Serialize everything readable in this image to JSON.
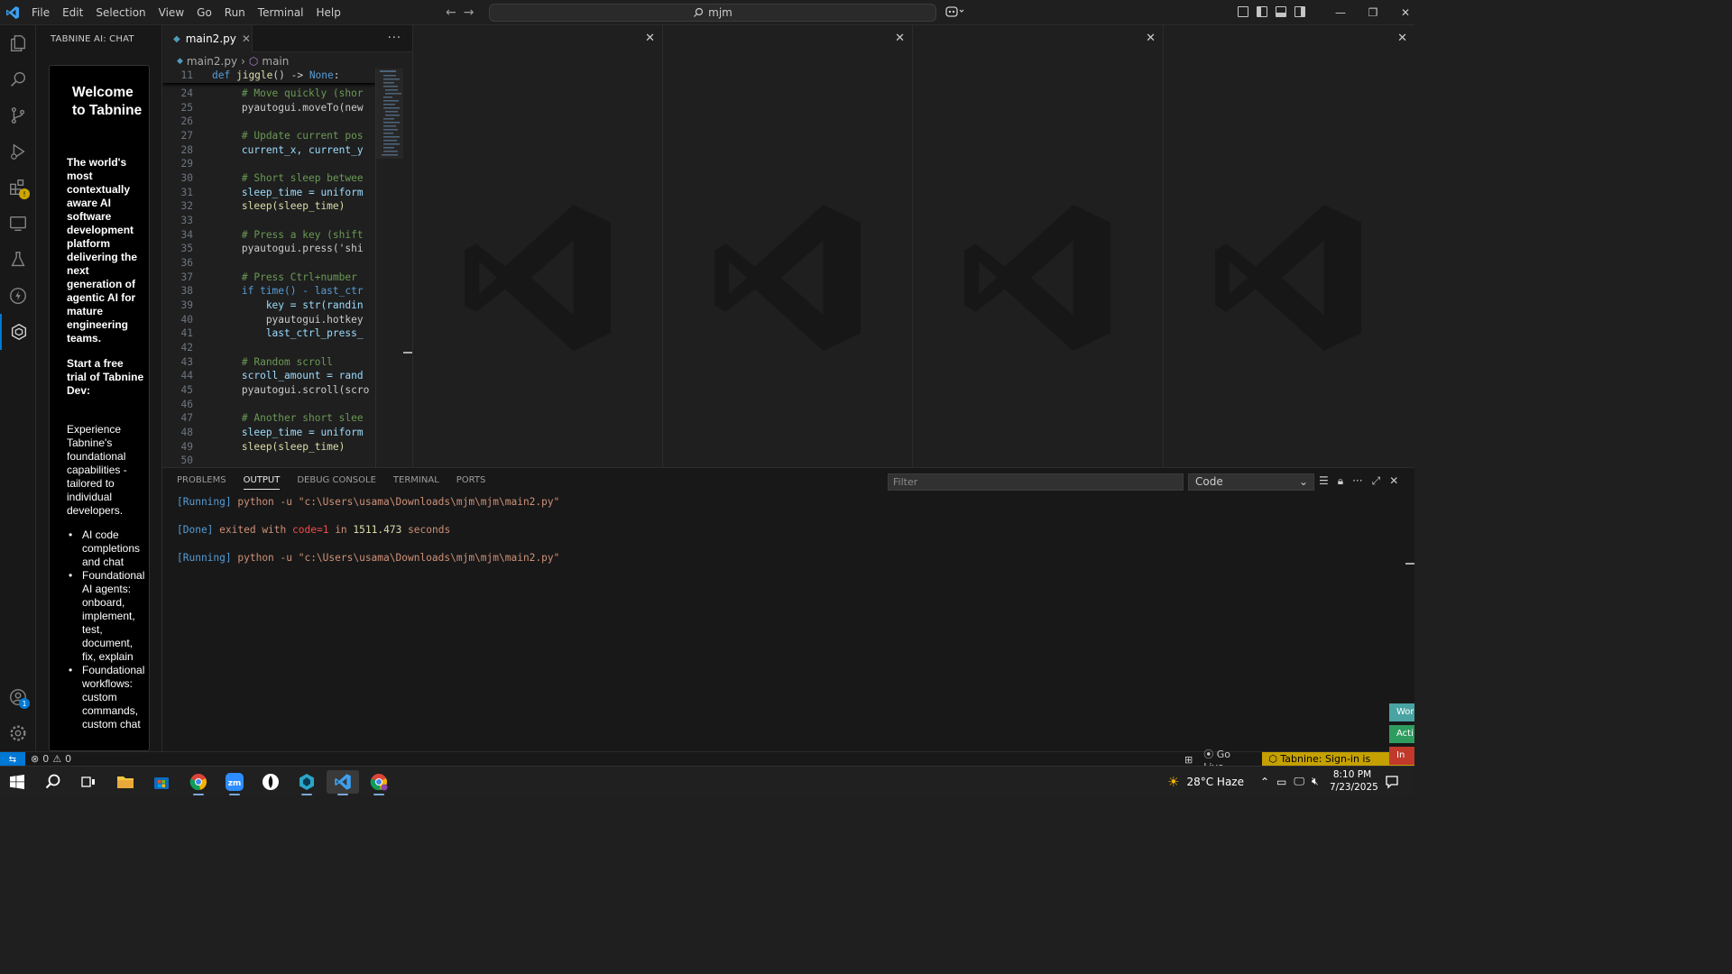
{
  "titlebar": {
    "menu": [
      "File",
      "Edit",
      "Selection",
      "View",
      "Go",
      "Run",
      "Terminal",
      "Help"
    ],
    "search": "mjm"
  },
  "sidebar": {
    "title": "TABNINE AI: CHAT",
    "welcome": "Welcome to Tabnine",
    "tagline": "The world's most contextually aware AI software development platform delivering the next generation of agentic AI for mature engineering teams.",
    "trial": "Start a free trial of Tabnine Dev:",
    "experience": "Experience Tabnine's foundational capabilities - tailored to individual developers.",
    "features": [
      "AI code completions and chat",
      "Foundational AI agents: onboard, implement, test, document, fix, explain",
      "Foundational workflows: custom commands, custom chat"
    ]
  },
  "editor": {
    "tab": "main2.py",
    "breadcrumb_file": "main2.py",
    "breadcrumb_symbol": "main",
    "sticky": {
      "num": "11",
      "kw": "def",
      "fn": "jiggle",
      "rest": "() -> ",
      "none": "None",
      ":": ":"
    },
    "lines": [
      {
        "n": "24",
        "t": "        # Move quickly (shor",
        "c": "cm"
      },
      {
        "n": "25",
        "t": "        pyautogui.moveTo(new",
        "c": "tx"
      },
      {
        "n": "26",
        "t": "",
        "c": "tx"
      },
      {
        "n": "27",
        "t": "        # Update current pos",
        "c": "cm"
      },
      {
        "n": "28",
        "t": "        current_x, current_y",
        "c": "vr"
      },
      {
        "n": "29",
        "t": "",
        "c": "tx"
      },
      {
        "n": "30",
        "t": "        # Short sleep betwee",
        "c": "cm"
      },
      {
        "n": "31",
        "t": "        sleep_time = uniform",
        "c": "vr"
      },
      {
        "n": "32",
        "t": "        sleep(sleep_time)",
        "c": "fn"
      },
      {
        "n": "33",
        "t": "",
        "c": "tx"
      },
      {
        "n": "34",
        "t": "        # Press a key (shift",
        "c": "cm"
      },
      {
        "n": "35",
        "t": "        pyautogui.press('shi",
        "c": "tx"
      },
      {
        "n": "36",
        "t": "",
        "c": "tx"
      },
      {
        "n": "37",
        "t": "        # Press Ctrl+number ",
        "c": "cm"
      },
      {
        "n": "38",
        "t": "        if time() - last_ctr",
        "c": "kw"
      },
      {
        "n": "39",
        "t": "            key = str(randin",
        "c": "vr"
      },
      {
        "n": "40",
        "t": "            pyautogui.hotkey",
        "c": "tx"
      },
      {
        "n": "41",
        "t": "            last_ctrl_press_",
        "c": "vr"
      },
      {
        "n": "42",
        "t": "",
        "c": "tx"
      },
      {
        "n": "43",
        "t": "        # Random scroll",
        "c": "cm"
      },
      {
        "n": "44",
        "t": "        scroll_amount = rand",
        "c": "vr"
      },
      {
        "n": "45",
        "t": "        pyautogui.scroll(scro",
        "c": "tx"
      },
      {
        "n": "46",
        "t": "",
        "c": "tx"
      },
      {
        "n": "47",
        "t": "        # Another short slee",
        "c": "cm"
      },
      {
        "n": "48",
        "t": "        sleep_time = uniform",
        "c": "vr"
      },
      {
        "n": "49",
        "t": "        sleep(sleep_time)",
        "c": "fn"
      },
      {
        "n": "50",
        "t": "",
        "c": "tx"
      }
    ]
  },
  "panel": {
    "tabs": [
      "PROBLEMS",
      "OUTPUT",
      "DEBUG CONSOLE",
      "TERMINAL",
      "PORTS"
    ],
    "active_tab": "OUTPUT",
    "filter_placeholder": "Filter",
    "output_channel": "Code",
    "output": {
      "run1_tag": "[Running]",
      "run1_cmd": "python -u \"c:\\Users\\usama\\Downloads\\mjm\\mjm\\main2.py\"",
      "done_tag": "[Done]",
      "done_a": "exited with",
      "done_code": "code=1",
      "done_in": "in",
      "done_secs": "1511.473",
      "done_b": "seconds",
      "run2_tag": "[Running]",
      "run2_cmd": "python -u \"c:\\Users\\usama\\Downloads\\mjm\\mjm\\main2.py\""
    }
  },
  "statusbar": {
    "errors": "0",
    "warnings": "0",
    "golive": "Go Live",
    "tabnine": "Tabnine: Sign-in is required",
    "side_tags": [
      "Wor",
      "Acti",
      "In Ac"
    ]
  },
  "taskbar": {
    "weather": "28°C  Haze",
    "time": "8:10 PM",
    "date": "7/23/2025"
  },
  "colors": {
    "accent": "#0078d4",
    "tabnine_warn": "#c4a000"
  }
}
